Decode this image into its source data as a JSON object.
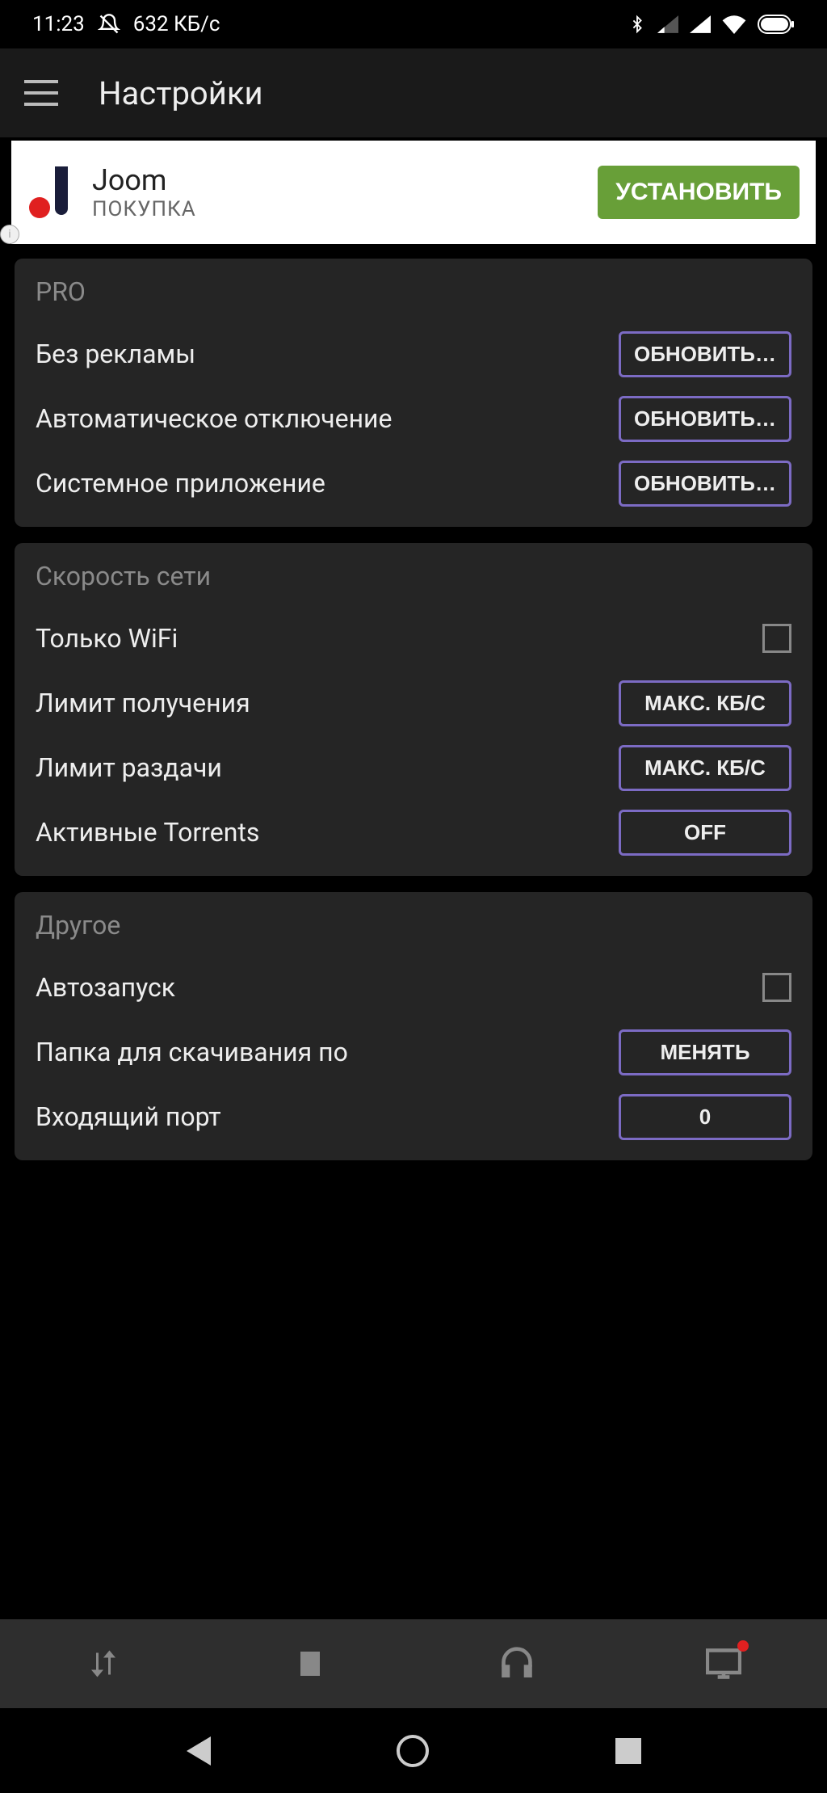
{
  "status": {
    "time": "11:23",
    "speed": "632 КБ/с"
  },
  "appbar": {
    "title": "Настройки"
  },
  "ad": {
    "title": "Joom",
    "subtitle": "ПОКУПКА",
    "button": "УСТАНОВИТЬ"
  },
  "pro": {
    "header": "PRO",
    "items": [
      {
        "label": "Без рекламы",
        "button": "ОБНОВИТЬ…"
      },
      {
        "label": "Автоматическое отключение",
        "button": "ОБНОВИТЬ…"
      },
      {
        "label": "Системное приложение",
        "button": "ОБНОВИТЬ…"
      }
    ]
  },
  "network": {
    "header": "Скорость сети",
    "wifi_only": "Только WiFi",
    "download_limit_label": "Лимит получения",
    "download_limit_value": "МАКС. КБ/С",
    "upload_limit_label": "Лимит раздачи",
    "upload_limit_value": "МАКС. КБ/С",
    "active_torrents_label": "Активные Torrents",
    "active_torrents_value": "OFF"
  },
  "other": {
    "header": "Другое",
    "autostart": "Автозапуск",
    "folder_label": "Папка для скачивания по",
    "folder_button": "МЕНЯТЬ",
    "port_label": "Входящий порт",
    "port_value": "0"
  }
}
